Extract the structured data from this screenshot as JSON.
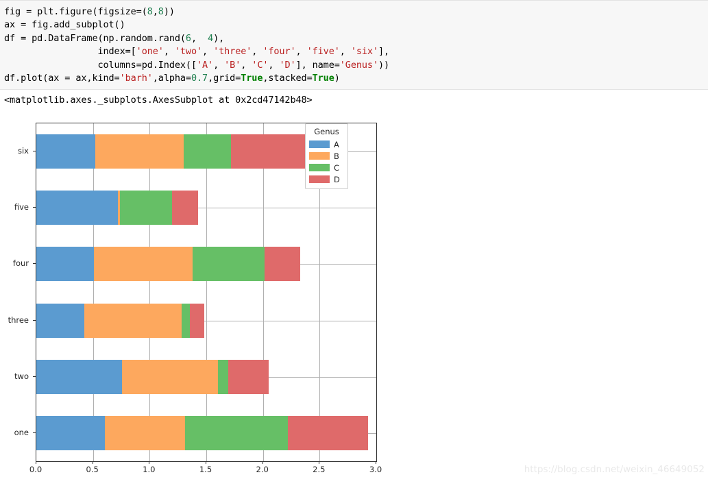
{
  "notebook": {
    "code_lines": [
      [
        {
          "t": "plain",
          "s": "fig = plt.figure(figsize="
        },
        {
          "t": "op",
          "s": ""
        },
        {
          "t": "plain",
          "s": "("
        },
        {
          "t": "num",
          "s": "8"
        },
        {
          "t": "plain",
          "s": ","
        },
        {
          "t": "num",
          "s": "8"
        },
        {
          "t": "plain",
          "s": "))"
        }
      ],
      [
        {
          "t": "plain",
          "s": "ax = fig.add_subplot()"
        }
      ],
      [
        {
          "t": "plain",
          "s": "df = pd.DataFrame(np.random.rand("
        },
        {
          "t": "num",
          "s": "6"
        },
        {
          "t": "plain",
          "s": ",  "
        },
        {
          "t": "num",
          "s": "4"
        },
        {
          "t": "plain",
          "s": "),"
        }
      ],
      [
        {
          "t": "plain",
          "s": "                 index=["
        },
        {
          "t": "str",
          "s": "'one'"
        },
        {
          "t": "plain",
          "s": ", "
        },
        {
          "t": "str",
          "s": "'two'"
        },
        {
          "t": "plain",
          "s": ", "
        },
        {
          "t": "str",
          "s": "'three'"
        },
        {
          "t": "plain",
          "s": ", "
        },
        {
          "t": "str",
          "s": "'four'"
        },
        {
          "t": "plain",
          "s": ", "
        },
        {
          "t": "str",
          "s": "'five'"
        },
        {
          "t": "plain",
          "s": ", "
        },
        {
          "t": "str",
          "s": "'six'"
        },
        {
          "t": "plain",
          "s": "],"
        }
      ],
      [
        {
          "t": "plain",
          "s": "                 columns=pd.Index(["
        },
        {
          "t": "str",
          "s": "'A'"
        },
        {
          "t": "plain",
          "s": ", "
        },
        {
          "t": "str",
          "s": "'B'"
        },
        {
          "t": "plain",
          "s": ", "
        },
        {
          "t": "str",
          "s": "'C'"
        },
        {
          "t": "plain",
          "s": ", "
        },
        {
          "t": "str",
          "s": "'D'"
        },
        {
          "t": "plain",
          "s": "], name="
        },
        {
          "t": "str",
          "s": "'Genus'"
        },
        {
          "t": "plain",
          "s": "))"
        }
      ],
      [
        {
          "t": "plain",
          "s": "df.plot(ax = ax,kind="
        },
        {
          "t": "str",
          "s": "'barh'"
        },
        {
          "t": "plain",
          "s": ",alpha="
        },
        {
          "t": "num",
          "s": "0.7"
        },
        {
          "t": "plain",
          "s": ",grid="
        },
        {
          "t": "kw",
          "s": "True"
        },
        {
          "t": "plain",
          "s": ",stacked="
        },
        {
          "t": "kw",
          "s": "True"
        },
        {
          "t": "plain",
          "s": ")"
        }
      ]
    ],
    "output_repr": "<matplotlib.axes._subplots.AxesSubplot at 0x2cd47142b48>",
    "watermark": "https://blog.csdn.net/weixin_46649052"
  },
  "chart_data": {
    "type": "bar",
    "orientation": "horizontal",
    "stacked": true,
    "title": "",
    "xlabel": "",
    "ylabel": "",
    "legend_title": "Genus",
    "legend_position": "upper right",
    "grid": true,
    "alpha": 0.7,
    "xlim": [
      0.0,
      3.0
    ],
    "xticks": [
      "0.0",
      "0.5",
      "1.0",
      "1.5",
      "2.0",
      "2.5",
      "3.0"
    ],
    "xtick_values": [
      0.0,
      0.5,
      1.0,
      1.5,
      2.0,
      2.5,
      3.0
    ],
    "categories": [
      "one",
      "two",
      "three",
      "four",
      "five",
      "six"
    ],
    "categories_top_to_bottom": [
      "six",
      "five",
      "four",
      "three",
      "two",
      "one"
    ],
    "series": [
      {
        "name": "A",
        "color": "#5b9bd0",
        "values": [
          0.604,
          0.755,
          0.421,
          0.506,
          0.718,
          0.518
        ]
      },
      {
        "name": "B",
        "color": "#fda85e",
        "values": [
          0.707,
          0.846,
          0.86,
          0.873,
          0.02,
          0.78
        ]
      },
      {
        "name": "C",
        "color": "#66bf66",
        "values": [
          0.907,
          0.091,
          0.073,
          0.635,
          0.46,
          0.419
        ]
      },
      {
        "name": "D",
        "color": "#df6a6a",
        "values": [
          0.707,
          0.359,
          0.129,
          0.316,
          0.232,
          0.703
        ]
      }
    ],
    "totals": [
      2.925,
      2.051,
      1.483,
      2.33,
      1.43,
      2.42
    ]
  }
}
